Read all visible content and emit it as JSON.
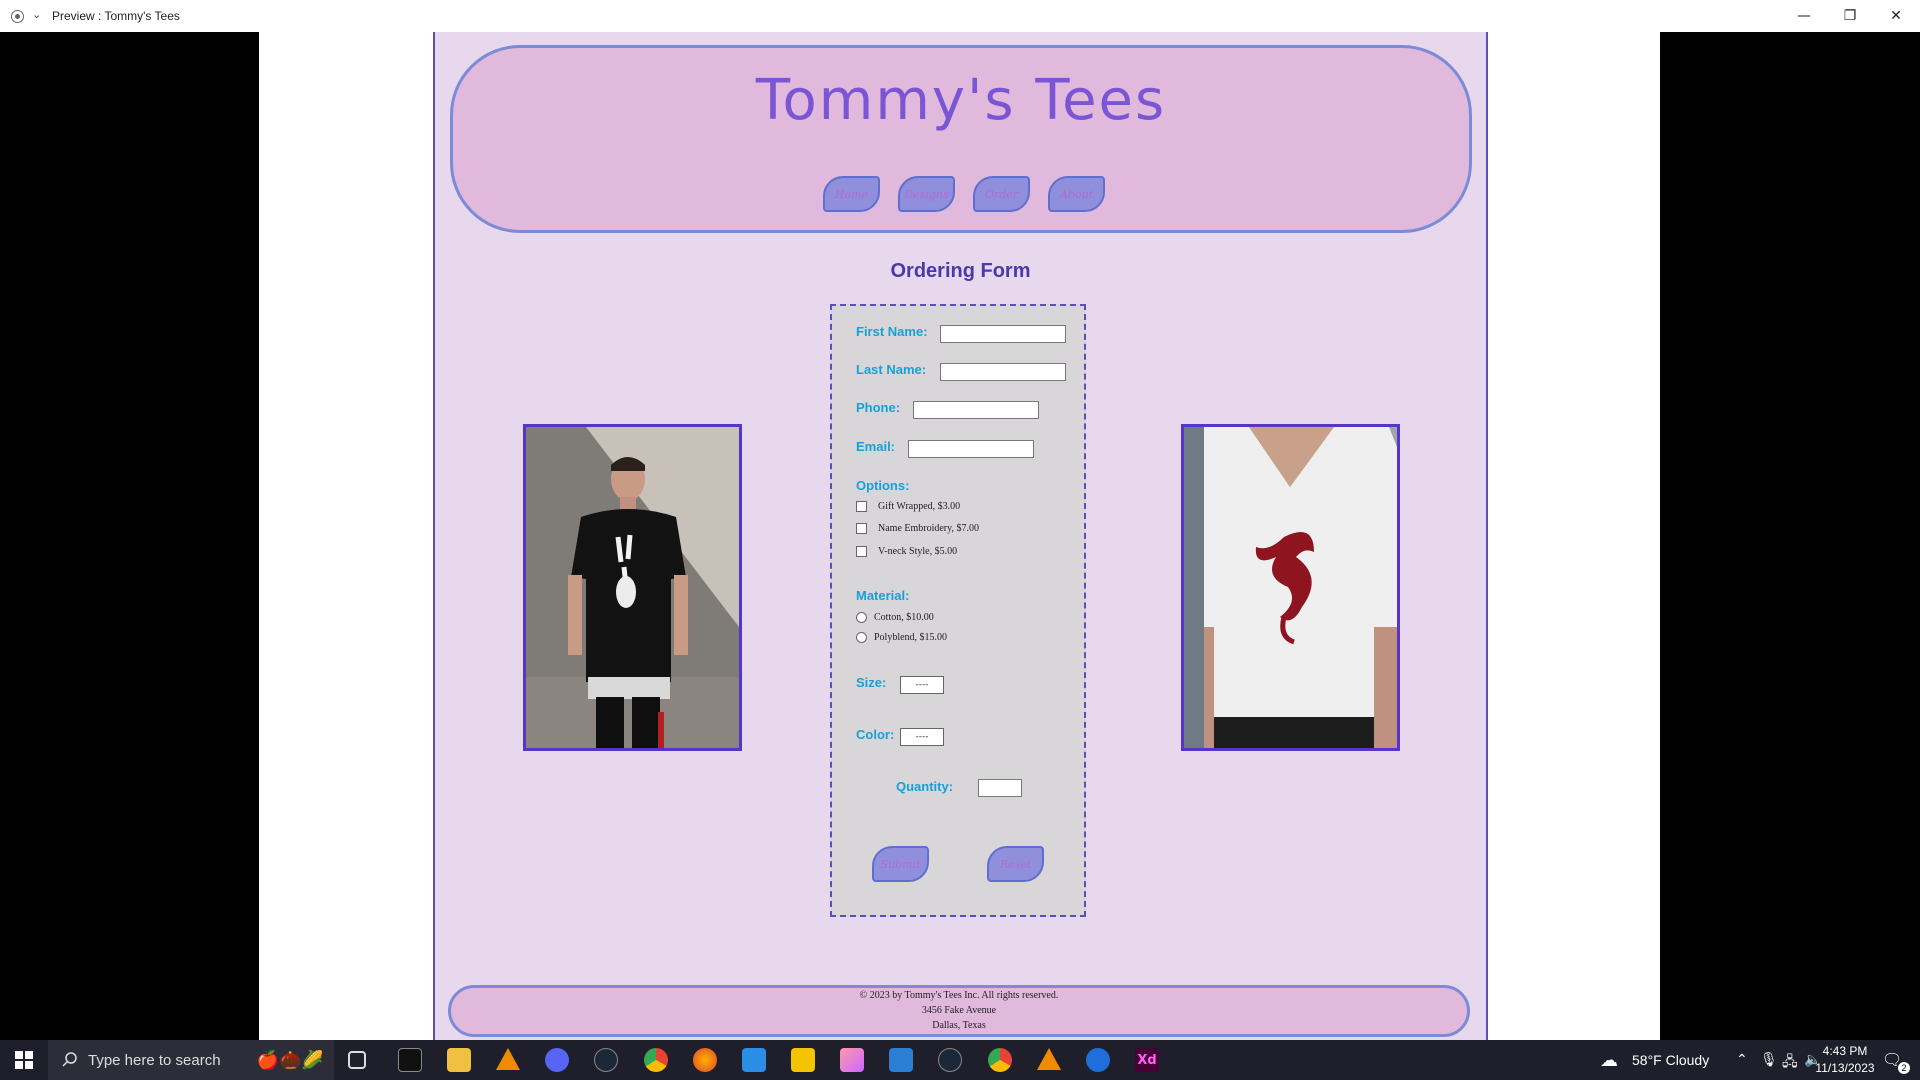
{
  "window": {
    "title": "Preview : Tommy's Tees",
    "minimize_glyph": "—",
    "restore_glyph": "❐",
    "close_glyph": "✕"
  },
  "site": {
    "title": "Tommy's  Tees",
    "nav": [
      {
        "label": "Home"
      },
      {
        "label": "Designs"
      },
      {
        "label": "Order"
      },
      {
        "label": "About"
      }
    ]
  },
  "form": {
    "heading": "Ordering Form",
    "first_name_label": "First Name:",
    "last_name_label": "Last Name:",
    "phone_label": "Phone:",
    "email_label": "Email:",
    "options_label": "Options:",
    "options": [
      {
        "label": "Gift Wrapped, $3.00",
        "checked": false
      },
      {
        "label": "Name Embroidery, $7.00",
        "checked": false
      },
      {
        "label": "V-neck Style, $5.00",
        "checked": false
      }
    ],
    "material_label": "Material:",
    "materials": [
      {
        "label": "Cotton, $10.00",
        "selected": false
      },
      {
        "label": "Polyblend, $15.00",
        "selected": false
      }
    ],
    "size_label": "Size:",
    "size_value": "----",
    "color_label": "Color:",
    "color_value": "----",
    "quantity_label": "Quantity:",
    "submit_label": "Submit",
    "reset_label": "Reset"
  },
  "footer": {
    "line1": "© 2023 by Tommy's Tees Inc. All rights reserved.",
    "line2": "3456 Fake Avenue",
    "line3": "Dallas, Texas"
  },
  "taskbar": {
    "search_placeholder": "Type here to search",
    "weather": "58°F  Cloudy",
    "time": "4:43 PM",
    "date": "11/13/2023",
    "notification_count": "2"
  },
  "colors": {
    "page_bg": "#e8d8ee",
    "header_bg": "#e0b9dc",
    "accent": "#5a4fbf",
    "label_blue": "#18a0d8",
    "title_purple": "#7a56d4"
  }
}
